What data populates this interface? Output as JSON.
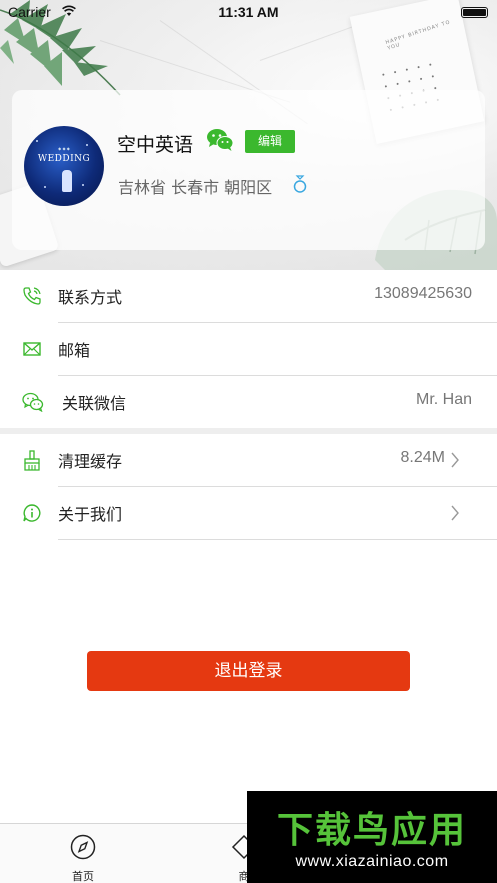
{
  "status_bar": {
    "carrier": "Carrier",
    "time": "11:31 AM",
    "icons": [
      "wifi-icon",
      "battery-icon"
    ]
  },
  "profile": {
    "name": "空中英语",
    "edit_label": "编辑",
    "location": "吉林省 长春市 朝阳区",
    "avatar_text": "WEDDING",
    "icons": [
      "wechat-icon",
      "ring-icon"
    ]
  },
  "contact_section": [
    {
      "icon": "phone-icon",
      "label": "联系方式",
      "value": "13089425630"
    },
    {
      "icon": "mail-icon",
      "label": "邮箱",
      "value": ""
    },
    {
      "icon": "wechat-icon",
      "label": "关联微信",
      "value": "Mr. Han"
    }
  ],
  "settings_section": [
    {
      "icon": "broom-icon",
      "label": "清理缓存",
      "value": "8.24M"
    },
    {
      "icon": "info-icon",
      "label": "关于我们",
      "value": ""
    }
  ],
  "logout_label": "退出登录",
  "tab_bar": {
    "items": [
      {
        "label": "首页",
        "icon": "compass-icon"
      },
      {
        "label": "商",
        "icon": "diamond-icon"
      }
    ]
  },
  "watermark": {
    "title": "下载鸟应用",
    "url": "www.xiazainiao.com"
  },
  "colors": {
    "accent_green": "#3bb82e",
    "logout_red": "#e53911",
    "watermark_green": "#56c33a"
  }
}
